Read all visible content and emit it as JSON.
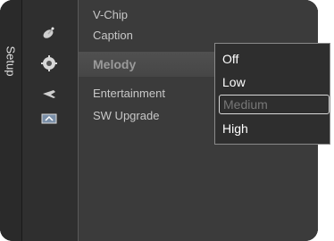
{
  "side_tab": {
    "label": "Setup"
  },
  "icons": [
    "satellite-dish-icon",
    "gear-icon",
    "wrench-icon",
    "upgrade-icon"
  ],
  "menu": {
    "items": [
      {
        "label": "V-Chip"
      },
      {
        "label": "Caption"
      },
      {
        "label": "Melody",
        "colon": ":"
      },
      {
        "label": "Entertainment",
        "colon": ":"
      },
      {
        "label": "SW Upgrade"
      }
    ]
  },
  "dropdown": {
    "options": [
      "Off",
      "Low",
      "Medium",
      "High"
    ],
    "selected": "Medium"
  }
}
